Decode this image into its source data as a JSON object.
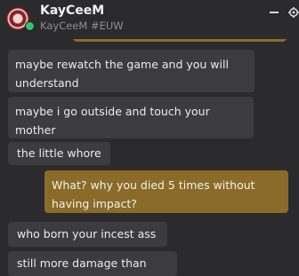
{
  "header": {
    "username": "KayCeeM",
    "riot_id": "KayCeeM #EUW",
    "status": "online",
    "icons": [
      "avatar",
      "minimize-icon",
      "gear-icon"
    ]
  },
  "messages": [
    {
      "direction": "incoming",
      "text": "maybe rewatch the game and you will\nunderstand"
    },
    {
      "direction": "incoming",
      "text": "maybe i go outside and touch your\nmother"
    },
    {
      "direction": "incoming",
      "text": "the little whore"
    },
    {
      "direction": "outgoing",
      "text": "What? why you died 5 times without\nhaving impact?"
    },
    {
      "direction": "incoming",
      "text": "who born your incest ass"
    },
    {
      "direction": "incoming",
      "text": "still more damage than you"
    }
  ],
  "colors": {
    "background": "#2b2b2d",
    "incoming_bubble": "#3c3c40",
    "outgoing_bubble": "#8a6b2a",
    "status_online": "#35c46b"
  }
}
